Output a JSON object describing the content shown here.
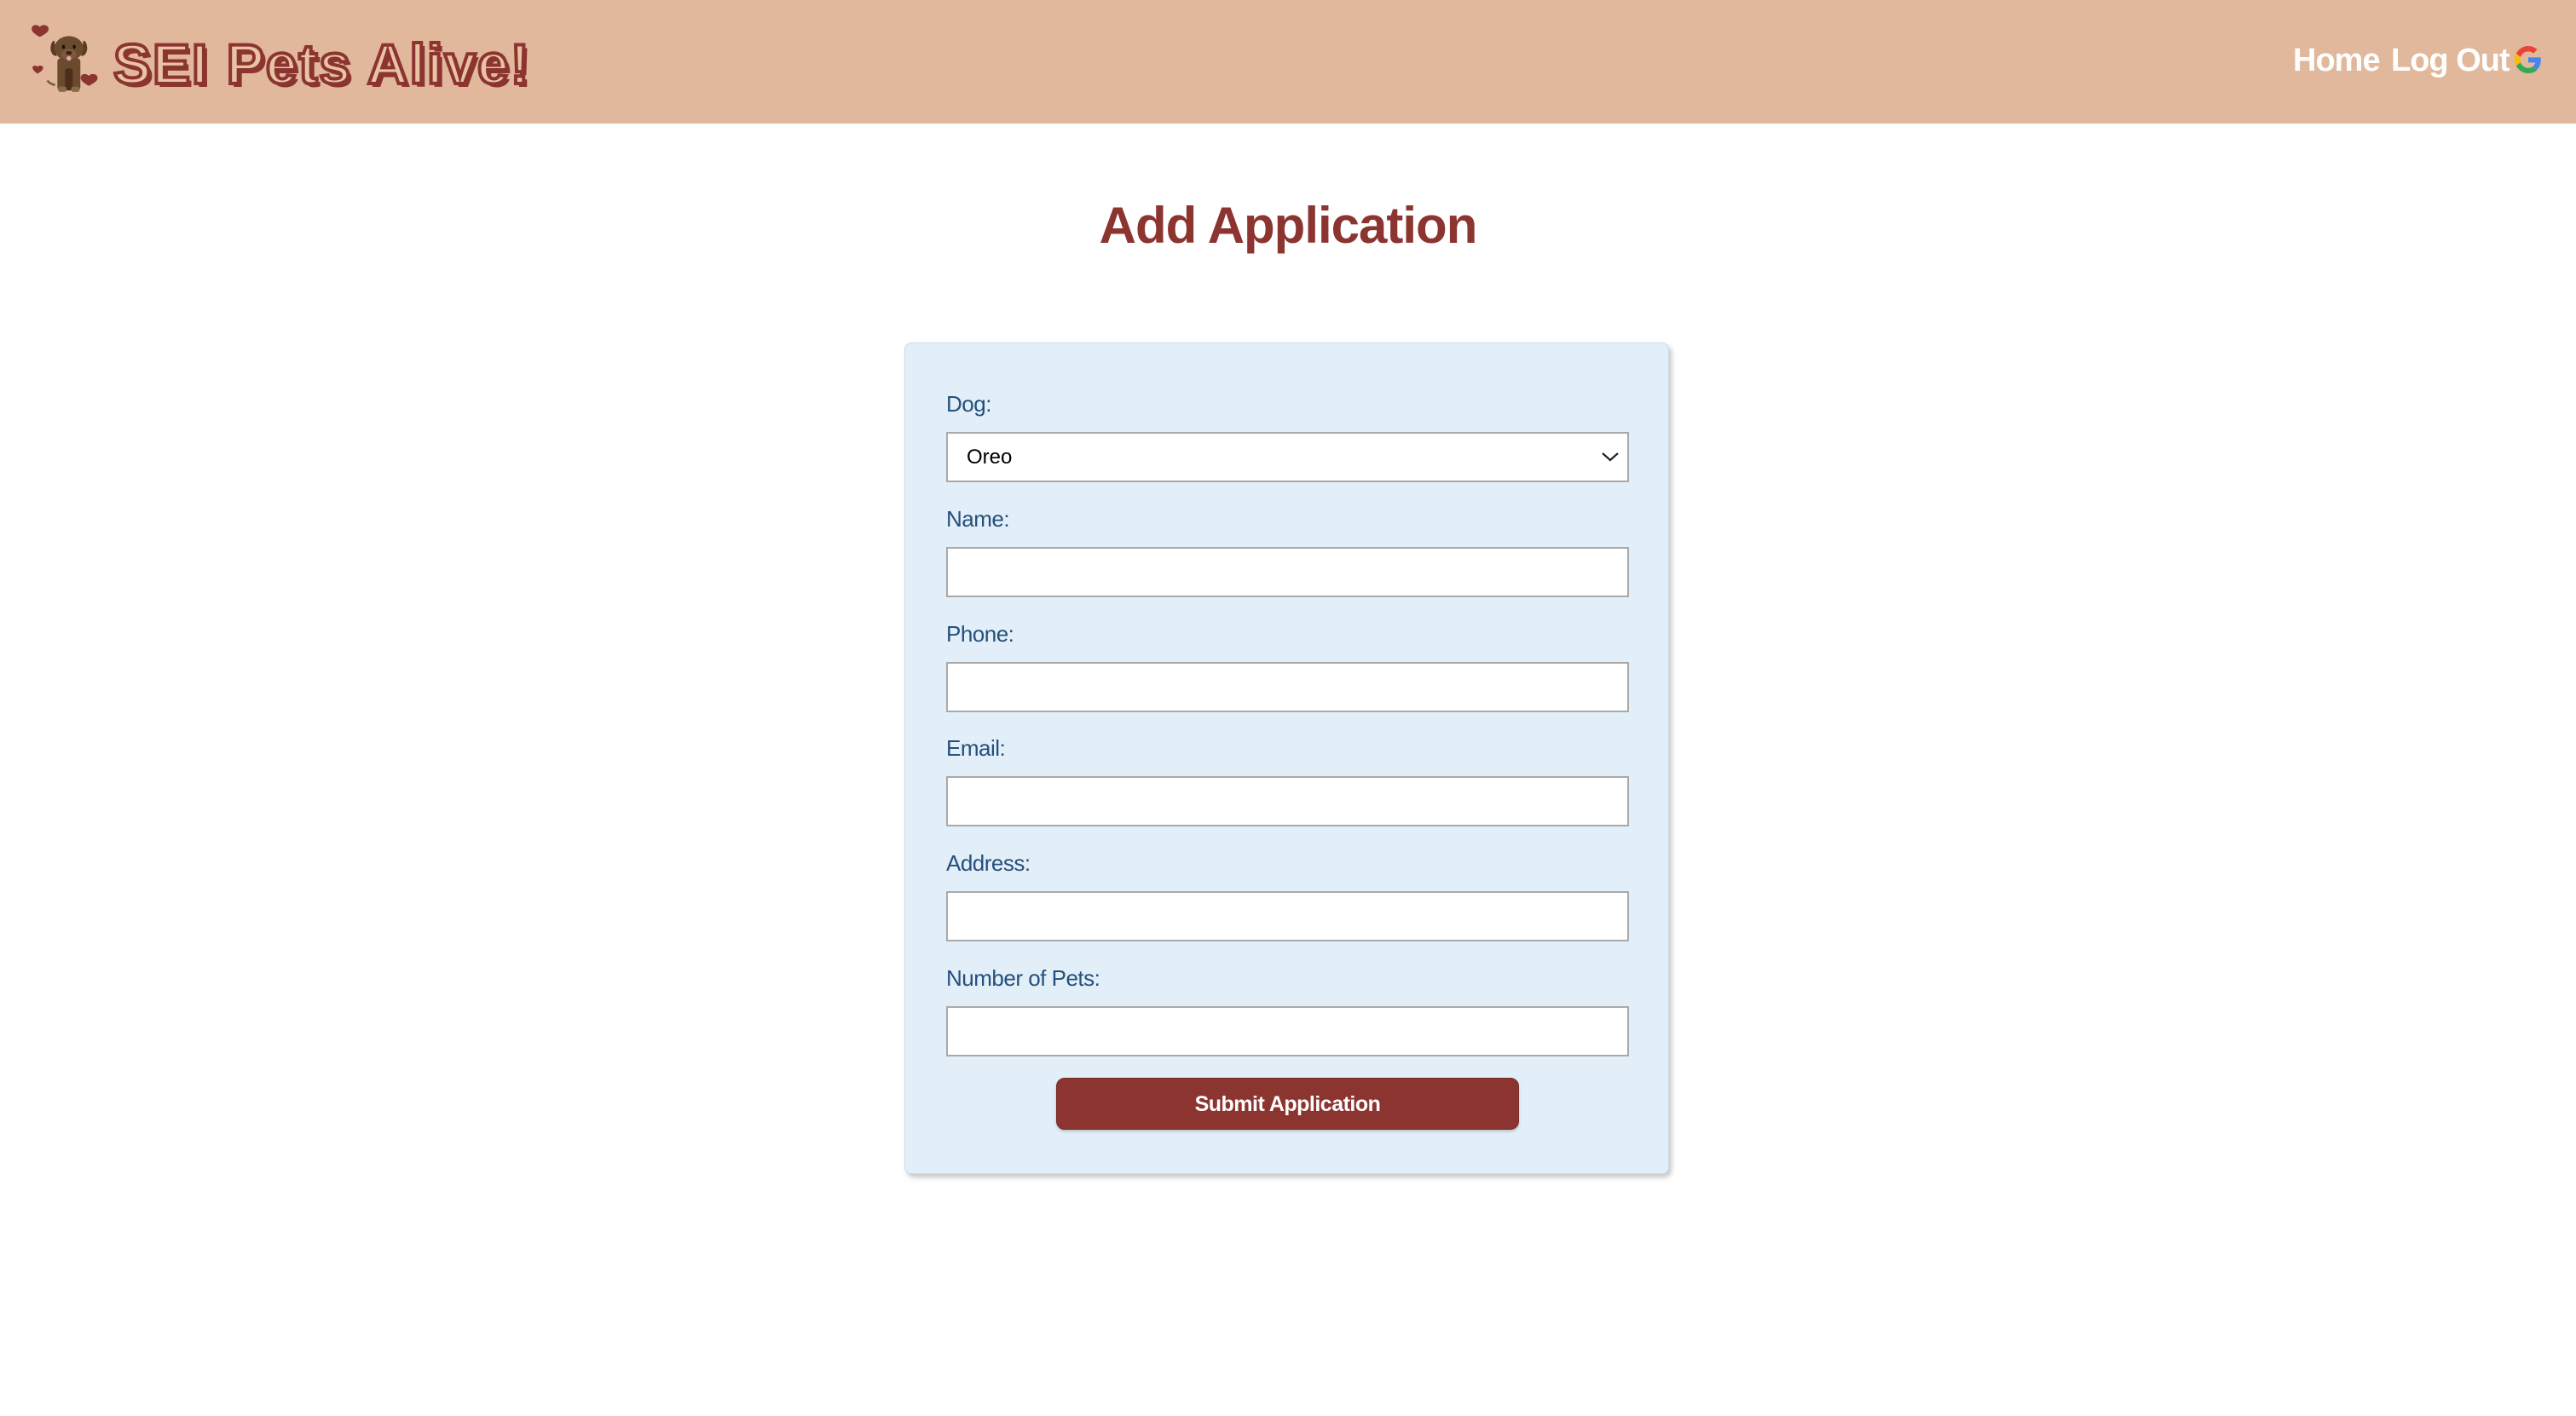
{
  "navbar": {
    "brand": "SEI Pets Alive!",
    "logo_icon": "dog-with-hearts-icon",
    "links": [
      {
        "label": "Home"
      },
      {
        "label": "Log Out"
      }
    ],
    "google_icon": "google-icon"
  },
  "page": {
    "title": "Add Application"
  },
  "form": {
    "dog": {
      "label": "Dog:",
      "selected": "Oreo"
    },
    "fields": [
      {
        "label": "Name:",
        "value": "",
        "placeholder": ""
      },
      {
        "label": "Phone:",
        "value": "",
        "placeholder": ""
      },
      {
        "label": "Email:",
        "value": "",
        "placeholder": ""
      },
      {
        "label": "Address:",
        "value": "",
        "placeholder": ""
      },
      {
        "label": "Number of Pets:",
        "value": "",
        "placeholder": ""
      }
    ],
    "submit_label": "Submit Application"
  },
  "colors": {
    "navbar_bg": "#e1b89b",
    "brand_accent": "#8b3430",
    "card_bg": "#e3eff8",
    "label_color": "#244f7d"
  }
}
